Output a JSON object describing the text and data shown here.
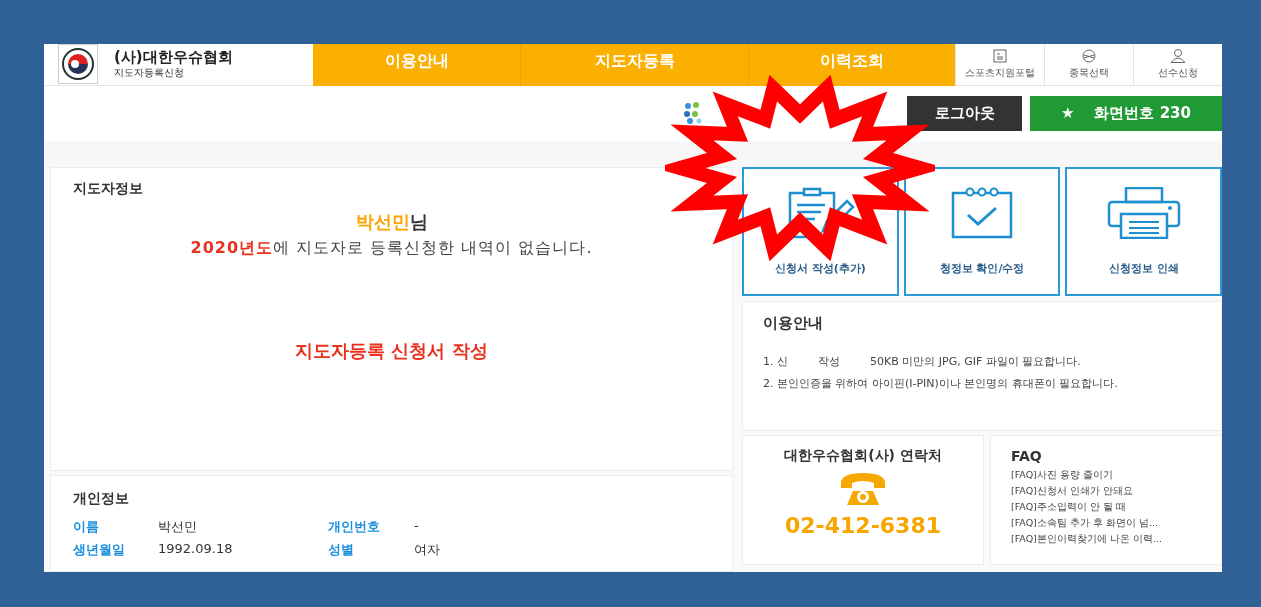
{
  "header": {
    "org_name": "(사)대한우슈협회",
    "org_subtitle": "지도자등록신청",
    "nav": [
      {
        "label": "이용안내"
      },
      {
        "label": "지도자등록"
      },
      {
        "label": "이력조회"
      }
    ],
    "utility_links": [
      {
        "kind": "portal",
        "label": "스포츠지원포털"
      },
      {
        "kind": "sport",
        "label": "종목선택"
      },
      {
        "kind": "player",
        "label": "선수신청"
      }
    ]
  },
  "account": {
    "logout": "로그아웃",
    "star": "★",
    "screen_number": "화면번호 230"
  },
  "coach_info": {
    "title": "지도자정보",
    "name": "박선민",
    "honorific": "님",
    "year": "2020년도",
    "notice": "에 지도자로 등록신청한 내역이 없습니다.",
    "action": "지도자등록 신청서 작성"
  },
  "personal_info": {
    "title": "개인정보",
    "fields": [
      {
        "label": "이름",
        "value": "박선민"
      },
      {
        "label": "개인번호",
        "value": "-"
      },
      {
        "label": "생년월일",
        "value": "1992.09.18"
      },
      {
        "label": "성별",
        "value": "여자"
      }
    ]
  },
  "action_cards": [
    {
      "kind": "write",
      "label": "신청서 작성(추가)"
    },
    {
      "kind": "check",
      "label": "청정보 확인/수정"
    },
    {
      "kind": "print",
      "label": "신청정보 인쇄"
    }
  ],
  "guide": {
    "title": "이용안내",
    "items": [
      {
        "segments": [
          "1. 신",
          "작성",
          "50KB 미만의 JPG, GIF 파일이 필요합니다."
        ]
      },
      {
        "segments": [
          "2. 본인인증을 위하여 아이핀(I-PIN)이나 본인명의 휴대폰이 필요합니다."
        ]
      }
    ]
  },
  "contact": {
    "title": "대한우슈협회(사) 연락처",
    "phone": "02-412-6381"
  },
  "faq": {
    "title": "FAQ",
    "items": [
      "[FAQ]사진 용량 줄이기",
      "[FAQ]신청서 인쇄가 안돼요",
      "[FAQ]주소입력이 안 될 때",
      "[FAQ]소속팀 추가 후 화면이 넘...",
      "[FAQ]본인이력찾기에 나온 이력..."
    ]
  }
}
